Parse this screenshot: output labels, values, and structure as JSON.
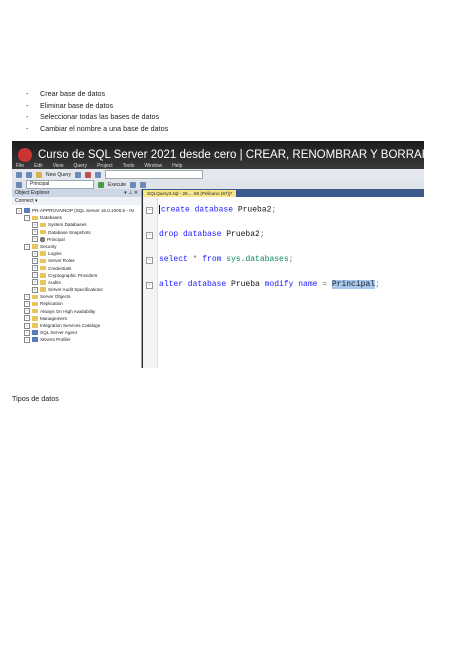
{
  "bullets": [
    {
      "dash": "-",
      "text": "Crear base de datos"
    },
    {
      "dash": "-",
      "text": "Eliminar base de datos"
    },
    {
      "dash": "-",
      "text": "Seleccionar todas las bases de datos"
    },
    {
      "dash": "-",
      "text": "Cambiar el nombre a una base de datos"
    }
  ],
  "screenshot": {
    "video_title": "Curso de SQL Server 2021 desde cero | CREAR, RENOMBRAR Y BORRAR UNA",
    "menu": [
      "File",
      "Edit",
      "View",
      "Query",
      "Project",
      "Tools",
      "Window",
      "Help"
    ],
    "toolbar": {
      "new_query": "New Query",
      "database_combo": "Principal",
      "execute": "Execute"
    },
    "object_explorer": {
      "title": "Object Explorer",
      "connect": "Connect ▾",
      "tree": [
        {
          "label": "PR-APPROVAINOP (SQL Server 16.0.1000.6 - IN",
          "indent": 0,
          "icon": "server"
        },
        {
          "label": "Databases",
          "indent": 1,
          "icon": "folder"
        },
        {
          "label": "System Databases",
          "indent": 2,
          "icon": "folder"
        },
        {
          "label": "Database Snapshots",
          "indent": 2,
          "icon": "folder"
        },
        {
          "label": "Principal",
          "indent": 2,
          "icon": "database"
        },
        {
          "label": "Security",
          "indent": 1,
          "icon": "folder"
        },
        {
          "label": "Logins",
          "indent": 2,
          "icon": "folder"
        },
        {
          "label": "Server Roles",
          "indent": 2,
          "icon": "folder"
        },
        {
          "label": "Credentials",
          "indent": 2,
          "icon": "folder"
        },
        {
          "label": "Cryptographic Providers",
          "indent": 2,
          "icon": "folder"
        },
        {
          "label": "Audits",
          "indent": 2,
          "icon": "folder"
        },
        {
          "label": "Server Audit Specifications",
          "indent": 2,
          "icon": "folder"
        },
        {
          "label": "Server Objects",
          "indent": 1,
          "icon": "folder"
        },
        {
          "label": "Replication",
          "indent": 1,
          "icon": "folder"
        },
        {
          "label": "Always On High Availability",
          "indent": 1,
          "icon": "folder"
        },
        {
          "label": "Management",
          "indent": 1,
          "icon": "folder"
        },
        {
          "label": "Integration Services Catalogs",
          "indent": 1,
          "icon": "folder"
        },
        {
          "label": "SQL Server Agent",
          "indent": 1,
          "icon": "server"
        },
        {
          "label": "XEvent Profiler",
          "indent": 1,
          "icon": "server"
        }
      ]
    },
    "editor_tab": "SQLQuery2.sql - 26.....59 (Pelicano (67))*",
    "code": [
      {
        "parts": [
          [
            "kw",
            "create database "
          ],
          [
            "id",
            "Prueba2"
          ],
          [
            "op",
            ";"
          ]
        ]
      },
      {
        "parts": [
          [
            "kw",
            "drop database "
          ],
          [
            "id",
            "Prueba2"
          ],
          [
            "op",
            ";"
          ]
        ]
      },
      {
        "parts": [
          [
            "kw",
            "select "
          ],
          [
            "op",
            "* "
          ],
          [
            "kw",
            "from "
          ],
          [
            "fn",
            "sys.databases"
          ],
          [
            "op",
            ";"
          ]
        ]
      },
      {
        "parts": [
          [
            "kw",
            "alter database "
          ],
          [
            "id",
            "Prueba "
          ],
          [
            "kw",
            "modify name "
          ],
          [
            "op",
            "= "
          ],
          [
            "hl",
            "Principal"
          ],
          [
            "op",
            ";"
          ]
        ]
      }
    ]
  },
  "caption": "Tipos de datos"
}
